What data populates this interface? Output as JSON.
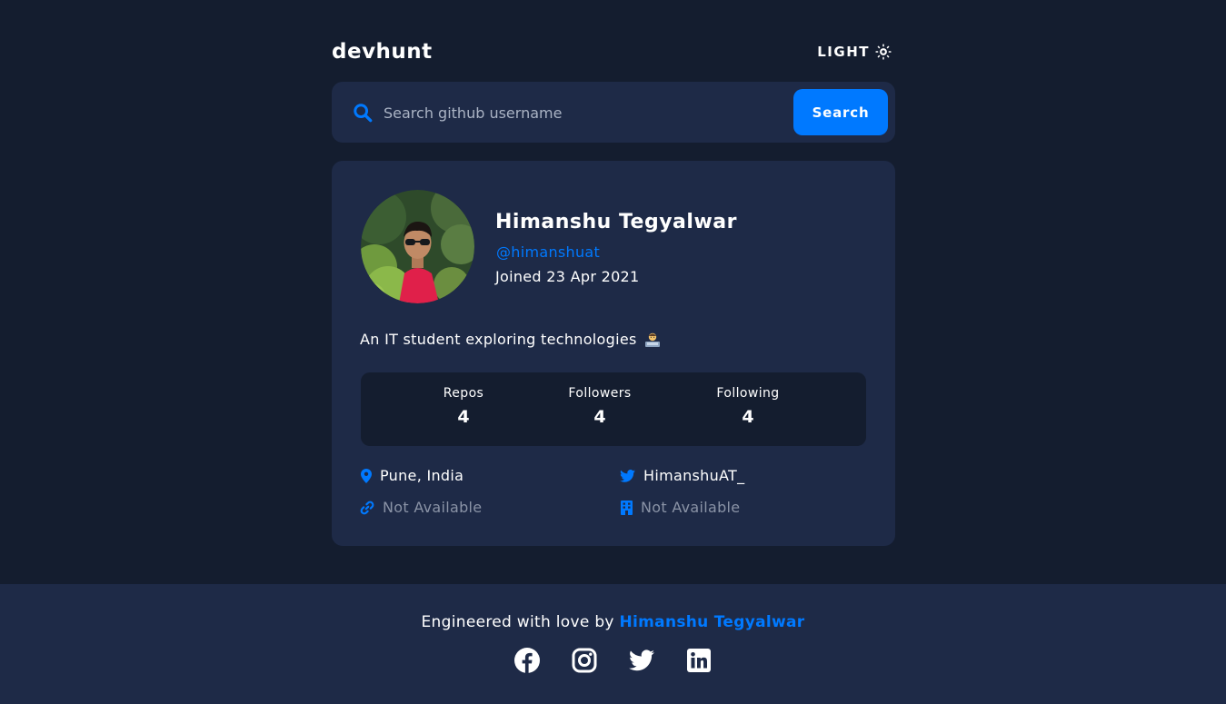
{
  "header": {
    "brand": "devhunt",
    "theme_toggle_label": "LIGHT",
    "theme_icon": "sun-icon"
  },
  "search": {
    "placeholder": "Search github username",
    "value": "",
    "button_label": "Search",
    "icon": "search-icon"
  },
  "profile": {
    "name": "Himanshu Tegyalwar",
    "login": "@himanshuat",
    "joined": "Joined 23 Apr 2021",
    "bio": "An IT student exploring technologies",
    "bio_emoji": "technologist-emoji",
    "stats": [
      {
        "label": "Repos",
        "value": "4"
      },
      {
        "label": "Followers",
        "value": "4"
      },
      {
        "label": "Following",
        "value": "4"
      }
    ],
    "location": "Pune, India",
    "twitter": "HimanshuAT_",
    "blog": "Not Available",
    "company": "Not Available"
  },
  "footer": {
    "text": "Engineered with love by",
    "author": "Himanshu Tegyalwar",
    "socials": [
      "facebook-icon",
      "instagram-icon",
      "twitter-icon",
      "linkedin-icon"
    ]
  },
  "colors": {
    "background": "#141d2f",
    "card": "#1e2a47",
    "accent": "#0079ff",
    "muted": "#8a93a6"
  }
}
